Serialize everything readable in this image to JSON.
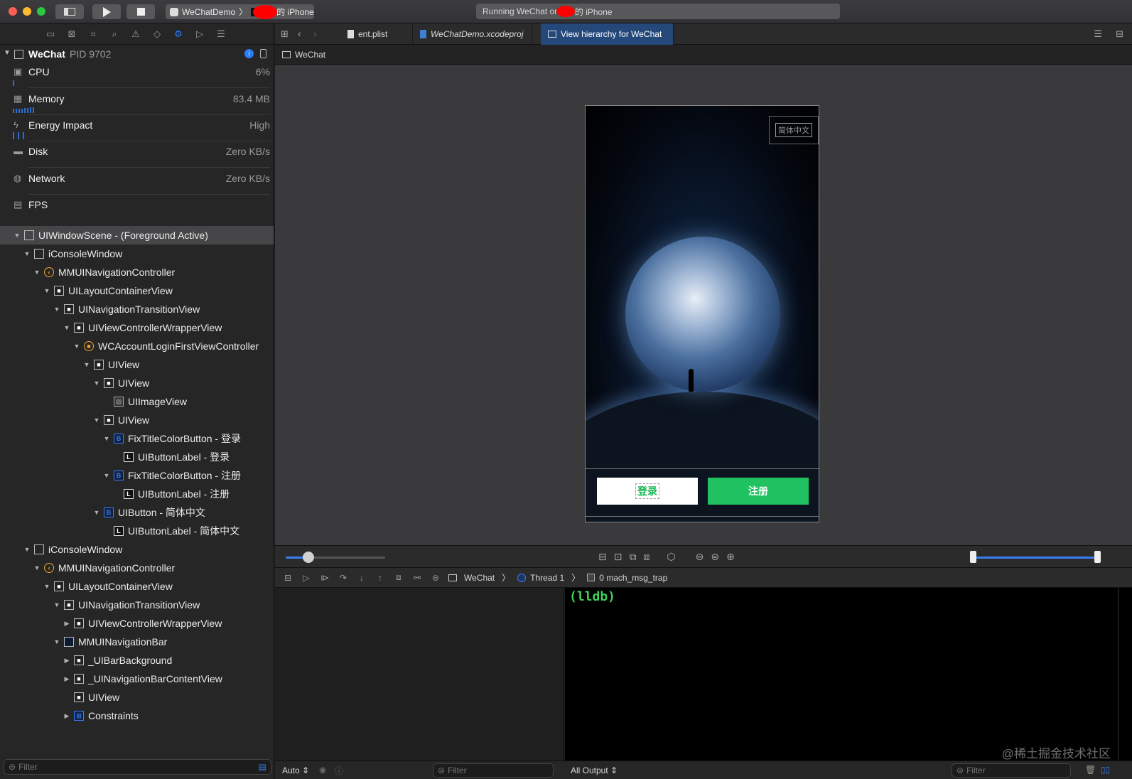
{
  "titlebar": {
    "scheme_app": "WeChatDemo",
    "scheme_device_suffix": "的 iPhone",
    "status_prefix": "Running WeChat on",
    "status_suffix": "的 iPhone"
  },
  "process": {
    "name": "WeChat",
    "pid": "PID 9702"
  },
  "gauges": [
    {
      "name": "CPU",
      "value": "6%"
    },
    {
      "name": "Memory",
      "value": "83.4 MB"
    },
    {
      "name": "Energy Impact",
      "value": "High"
    },
    {
      "name": "Disk",
      "value": "Zero KB/s"
    },
    {
      "name": "Network",
      "value": "Zero KB/s"
    },
    {
      "name": "FPS",
      "value": ""
    }
  ],
  "tree": [
    "UIWindowScene - (Foreground Active)",
    "iConsoleWindow",
    "MMUINavigationController",
    "UILayoutContainerView",
    "UINavigationTransitionView",
    "UIViewControllerWrapperView",
    "WCAccountLoginFirstViewController",
    "UIView",
    "UIView",
    "UIImageView",
    "UIView",
    "FixTitleColorButton - 登录",
    "UIButtonLabel - 登录",
    "FixTitleColorButton - 注册",
    "UIButtonLabel - 注册",
    "UIButton - 简体中文",
    "UIButtonLabel - 简体中文",
    "iConsoleWindow",
    "MMUINavigationController",
    "UILayoutContainerView",
    "UINavigationTransitionView",
    "UIViewControllerWrapperView",
    "MMUINavigationBar",
    "_UIBarBackground",
    "_UINavigationBarContentView",
    "UIView",
    "Constraints"
  ],
  "left_filter_placeholder": "Filter",
  "tabs": [
    "ent.plist",
    "WeChatDemo.xcodeproj",
    "View hierarchy for WeChat"
  ],
  "jumpbar": "WeChat",
  "phone": {
    "lang_button": "简体中文",
    "login_button": "登录",
    "register_button": "注册"
  },
  "debug": {
    "app": "WeChat",
    "thread": "Thread 1",
    "frame": "0 mach_msg_trap"
  },
  "console_prompt": "(lldb)",
  "bottom": {
    "auto": "Auto ⇕",
    "vars_filter": "Filter",
    "output": "All Output ⇕",
    "console_filter": "Filter"
  },
  "watermark": "@稀土掘金技术社区"
}
